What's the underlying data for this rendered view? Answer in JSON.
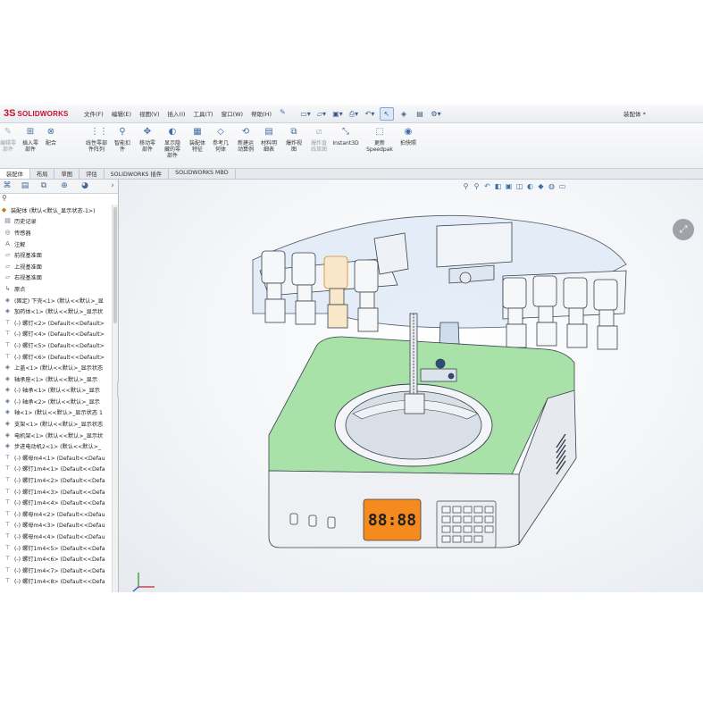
{
  "app": {
    "logo_mark": "3S",
    "logo_text": "SOLIDWORKS",
    "document_title": "装配体 *",
    "accent": "#c8102e"
  },
  "menu": [
    "文件(F)",
    "编辑(E)",
    "视图(V)",
    "插入(I)",
    "工具(T)",
    "窗口(W)",
    "帮助(H)"
  ],
  "quick_access_icons": [
    "new-icon",
    "open-icon",
    "save-icon",
    "print-icon",
    "undo-icon",
    "select-icon",
    "rebuild-icon",
    "options-icon"
  ],
  "commands": [
    {
      "label": "编辑零\n部件",
      "icon": "edit-component-icon",
      "dim": true
    },
    {
      "label": "插入零\n部件",
      "icon": "insert-component-icon",
      "dim": false
    },
    {
      "label": "配合",
      "icon": "mate-icon",
      "dim": false
    },
    {
      "label": "线性零部\n件阵列",
      "icon": "linear-pattern-icon",
      "dim": false
    },
    {
      "label": "智能扣\n件",
      "icon": "smart-fastener-icon",
      "dim": false
    },
    {
      "label": "移动零\n部件",
      "icon": "move-component-icon",
      "dim": false
    },
    {
      "label": "显示隐\n藏的零\n部件",
      "icon": "show-hidden-icon",
      "dim": false
    },
    {
      "label": "装配体\n特征",
      "icon": "assembly-feature-icon",
      "dim": false
    },
    {
      "label": "参考几\n何体",
      "icon": "reference-geometry-icon",
      "dim": false
    },
    {
      "label": "新建运\n动算例",
      "icon": "motion-study-icon",
      "dim": false
    },
    {
      "label": "材料明\n细表",
      "icon": "bom-icon",
      "dim": false
    },
    {
      "label": "爆炸视\n图",
      "icon": "exploded-view-icon",
      "dim": false
    },
    {
      "label": "爆炸直\n线草图",
      "icon": "explode-line-sketch-icon",
      "dim": true
    },
    {
      "label": "Instant3D",
      "icon": "instant3d-icon",
      "dim": false
    },
    {
      "label": "更新\nSpeedpak",
      "icon": "speedpak-icon",
      "dim": false
    },
    {
      "label": "拍快照",
      "icon": "snapshot-icon",
      "dim": false
    }
  ],
  "tabs": [
    "装配体",
    "布局",
    "草图",
    "评估",
    "SOLIDWORKS 插件",
    "SOLIDWORKS MBD"
  ],
  "active_tab": "装配体",
  "panel_tab_icons": [
    "feature-manager-icon",
    "property-manager-icon",
    "configuration-manager-icon",
    "dimxpert-icon",
    "display-manager-icon"
  ],
  "filter_icon": "filter-icon",
  "tree": [
    {
      "label": "装配体 (默认<默认_显示状态-1>)",
      "icon": "assembly-icon",
      "root": true
    },
    {
      "label": "历史记录",
      "icon": "history-icon"
    },
    {
      "label": "传感器",
      "icon": "sensor-icon"
    },
    {
      "label": "注解",
      "icon": "annotation-icon"
    },
    {
      "label": "前视基准面",
      "icon": "plane-icon"
    },
    {
      "label": "上视基准面",
      "icon": "plane-icon"
    },
    {
      "label": "右视基准面",
      "icon": "plane-icon"
    },
    {
      "label": "原点",
      "icon": "origin-icon"
    },
    {
      "label": "(固定) 下壳<1> (默认<<默认>_显",
      "icon": "part-icon"
    },
    {
      "label": "加药体<1> (默认<<默认>_显示状",
      "icon": "part-icon"
    },
    {
      "label": "(-) 螺钉<2> (Default<<Default>",
      "icon": "screw-icon"
    },
    {
      "label": "(-) 螺钉<4> (Default<<Default>",
      "icon": "screw-icon"
    },
    {
      "label": "(-) 螺钉<5> (Default<<Default>",
      "icon": "screw-icon"
    },
    {
      "label": "(-) 螺钉<6> (Default<<Default>",
      "icon": "screw-icon"
    },
    {
      "label": "上盖<1> (默认<<默认>_显示状态",
      "icon": "part-icon"
    },
    {
      "label": "轴承座<1> (默认<<默认>_显示",
      "icon": "part-icon"
    },
    {
      "label": "(-) 轴承<1> (默认<<默认>_显示",
      "icon": "part-icon"
    },
    {
      "label": "(-) 轴承<2> (默认<<默认>_显示",
      "icon": "part-icon"
    },
    {
      "label": "轴<1> (默认<<默认>_显示状态 1",
      "icon": "part-icon"
    },
    {
      "label": "支架<1> (默认<<默认>_显示状态",
      "icon": "part-icon"
    },
    {
      "label": "电机架<1> (默认<<默认>_显示状",
      "icon": "part-icon"
    },
    {
      "label": "步进电动机2<1> (默认<<默认>_",
      "icon": "part-icon"
    },
    {
      "label": "(-) 螺母m4<1> (Default<<Defau",
      "icon": "screw-icon"
    },
    {
      "label": "(-) 螺钉1m4<1> (Default<<Defa",
      "icon": "screw-icon"
    },
    {
      "label": "(-) 螺钉1m4<2> (Default<<Defa",
      "icon": "screw-icon"
    },
    {
      "label": "(-) 螺钉1m4<3> (Default<<Defa",
      "icon": "screw-icon"
    },
    {
      "label": "(-) 螺钉1m4<4> (Default<<Defa",
      "icon": "screw-icon"
    },
    {
      "label": "(-) 螺母m4<2> (Default<<Defau",
      "icon": "screw-icon"
    },
    {
      "label": "(-) 螺母m4<3> (Default<<Defau",
      "icon": "screw-icon"
    },
    {
      "label": "(-) 螺母m4<4> (Default<<Defau",
      "icon": "screw-icon"
    },
    {
      "label": "(-) 螺钉1m4<5> (Default<<Defa",
      "icon": "screw-icon"
    },
    {
      "label": "(-) 螺钉1m4<6> (Default<<Defa",
      "icon": "screw-icon"
    },
    {
      "label": "(-) 螺钉1m4<7> (Default<<Defa",
      "icon": "screw-icon"
    },
    {
      "label": "(-) 螺钉1m4<8> (Default<<Defa",
      "icon": "screw-icon"
    }
  ],
  "model": {
    "display_digits": "88:88",
    "body_color": "#a8e2a8",
    "display_color": "#f58a1f"
  },
  "heads_up_icons": [
    "zoom-fit-icon",
    "zoom-area-icon",
    "previous-view-icon",
    "section-view-icon",
    "view-orientation-icon",
    "display-style-icon",
    "hide-show-icon",
    "appearance-icon",
    "scene-icon",
    "monitor-icon"
  ],
  "expand_icon": "expand-icon"
}
